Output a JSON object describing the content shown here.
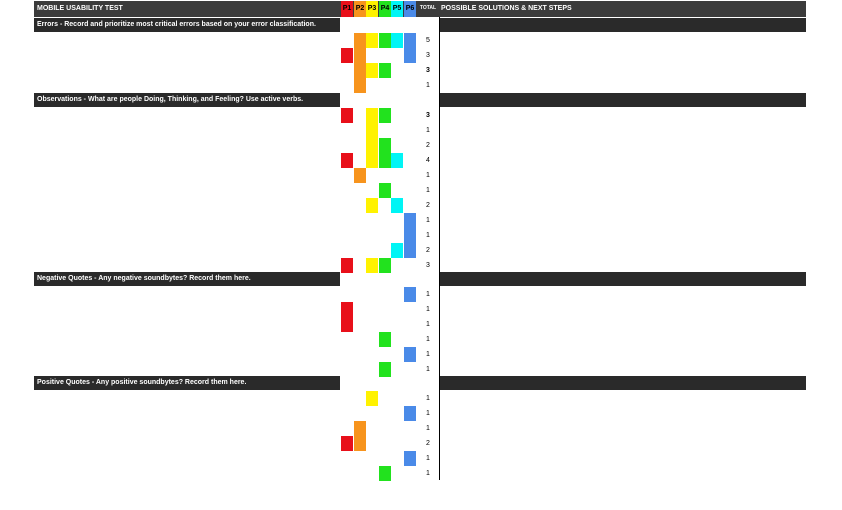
{
  "header": {
    "title": "MOBILE USABILITY TEST",
    "participants": [
      {
        "label": "P1",
        "color": "#e8101a"
      },
      {
        "label": "P2",
        "color": "#f7941d"
      },
      {
        "label": "P3",
        "color": "#fff200"
      },
      {
        "label": "P4",
        "color": "#22e21e"
      },
      {
        "label": "P5",
        "color": "#00f5f5"
      },
      {
        "label": "P6",
        "color": "#4a8ae8"
      }
    ],
    "total_label": "TOTAL",
    "solutions_label": "POSSIBLE SOLUTIONS & NEXT STEPS"
  },
  "sections": {
    "errors": "Errors - Record and prioritize most critical errors based on your error classification.",
    "observations": "Observations - What are people Doing, Thinking, and Feeling? Use active verbs.",
    "negative": "Negative Quotes - Any negative soundbytes? Record them here.",
    "positive": "Positive Quotes - Any positive soundbytes? Record them here."
  },
  "rows": [
    {
      "totals": "5",
      "marks": [
        0,
        1,
        1,
        1,
        1,
        1
      ]
    },
    {
      "totals": "3",
      "marks": [
        1,
        1,
        0,
        0,
        0,
        1
      ]
    },
    {
      "totals": "3",
      "marks": [
        0,
        1,
        1,
        1,
        0,
        0
      ]
    },
    {
      "totals": "1",
      "marks": [
        0,
        1,
        0,
        0,
        0,
        0
      ]
    },
    {
      "totals": "3",
      "marks": [
        1,
        0,
        1,
        1,
        0,
        0
      ]
    },
    {
      "totals": "1",
      "marks": [
        0,
        0,
        1,
        0,
        0,
        0
      ]
    },
    {
      "totals": "2",
      "marks": [
        0,
        0,
        1,
        1,
        0,
        0
      ]
    },
    {
      "totals": "4",
      "marks": [
        1,
        0,
        1,
        1,
        1,
        0
      ]
    },
    {
      "totals": "1",
      "marks": [
        0,
        1,
        0,
        0,
        0,
        0
      ]
    },
    {
      "totals": "1",
      "marks": [
        0,
        0,
        0,
        1,
        0,
        0
      ]
    },
    {
      "totals": "2",
      "marks": [
        0,
        0,
        1,
        0,
        1,
        0
      ]
    },
    {
      "totals": "1",
      "marks": [
        0,
        0,
        0,
        0,
        0,
        1
      ]
    },
    {
      "totals": "1",
      "marks": [
        0,
        0,
        0,
        0,
        0,
        1
      ]
    },
    {
      "totals": "2",
      "marks": [
        0,
        0,
        0,
        0,
        1,
        1
      ]
    },
    {
      "totals": "3",
      "marks": [
        1,
        0,
        1,
        1,
        0,
        0
      ]
    },
    {
      "totals": "1",
      "marks": [
        0,
        0,
        0,
        0,
        0,
        1
      ]
    },
    {
      "totals": "1",
      "marks": [
        1,
        0,
        0,
        0,
        0,
        0
      ]
    },
    {
      "totals": "1",
      "marks": [
        1,
        0,
        0,
        0,
        0,
        0
      ]
    },
    {
      "totals": "1",
      "marks": [
        0,
        0,
        0,
        1,
        0,
        0
      ]
    },
    {
      "totals": "1",
      "marks": [
        0,
        0,
        0,
        0,
        0,
        1
      ]
    },
    {
      "totals": "1",
      "marks": [
        0,
        0,
        0,
        1,
        0,
        0
      ]
    },
    {
      "totals": "1",
      "marks": [
        0,
        0,
        1,
        0,
        0,
        0
      ]
    },
    {
      "totals": "1",
      "marks": [
        0,
        0,
        0,
        0,
        0,
        1
      ]
    },
    {
      "totals": "1",
      "marks": [
        0,
        1,
        0,
        0,
        0,
        0
      ]
    },
    {
      "totals": "2",
      "marks": [
        1,
        1,
        0,
        0,
        0,
        0
      ]
    },
    {
      "totals": "1",
      "marks": [
        0,
        0,
        0,
        0,
        0,
        1
      ]
    },
    {
      "totals": "1",
      "marks": [
        0,
        0,
        0,
        1,
        0,
        0
      ]
    }
  ]
}
